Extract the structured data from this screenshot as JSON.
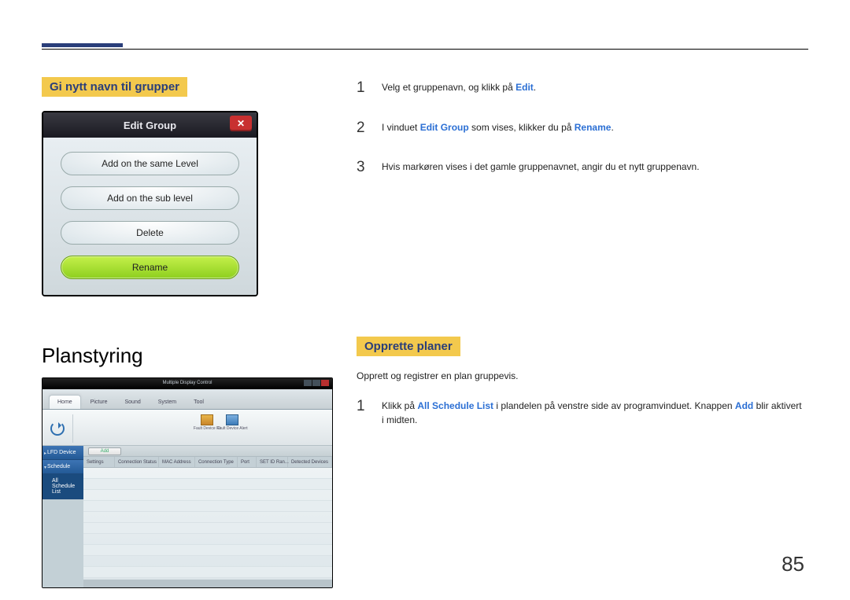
{
  "page_number": "85",
  "section_rename": {
    "heading": "Gi nytt navn til grupper",
    "dialog": {
      "title": "Edit Group",
      "btn_same_level": "Add on the same Level",
      "btn_sub_level": "Add on the sub level",
      "btn_delete": "Delete",
      "btn_rename": "Rename"
    },
    "steps": {
      "s1_num": "1",
      "s1_pre": "Velg et gruppenavn, og klikk på ",
      "s1_bold": "Edit",
      "s1_post": ".",
      "s2_num": "2",
      "s2_pre": "I vinduet ",
      "s2_bold1": "Edit Group",
      "s2_mid": " som vises, klikker du på ",
      "s2_bold2": "Rename",
      "s2_post": ".",
      "s3_num": "3",
      "s3_txt": "Hvis markøren vises i det gamle gruppenavnet, angir du et nytt gruppenavn."
    }
  },
  "section_sched": {
    "h1": "Planstyring",
    "heading": "Opprette planer",
    "intro": "Opprett og registrer en plan gruppevis.",
    "s1_num": "1",
    "s1_pre": "Klikk på ",
    "s1_bold1": "All Schedule List",
    "s1_mid": " i plandelen på venstre side av programvinduet. Knappen ",
    "s1_bold2": "Add",
    "s1_post": " blir aktivert i midten.",
    "mdc": {
      "caption": "Multiple Display Control",
      "tabs": {
        "home": "Home",
        "picture": "Picture",
        "sound": "Sound",
        "system": "System",
        "tool": "Tool"
      },
      "ribbon_icons": {
        "fd_id": "Fault Device\nID",
        "fd_alert": "Fault Device\nAlert"
      },
      "add_button": "Add",
      "side": {
        "lfd": "LFD Device",
        "schedule": "Schedule",
        "all_list": "All Schedule List"
      },
      "headers": {
        "c1": "Settings",
        "c2": "Connection Status",
        "c3": "MAC Address",
        "c4": "Connection Type",
        "c5": "Port",
        "c6": "SET ID Ran...",
        "c7": "Detected Devices"
      }
    }
  }
}
